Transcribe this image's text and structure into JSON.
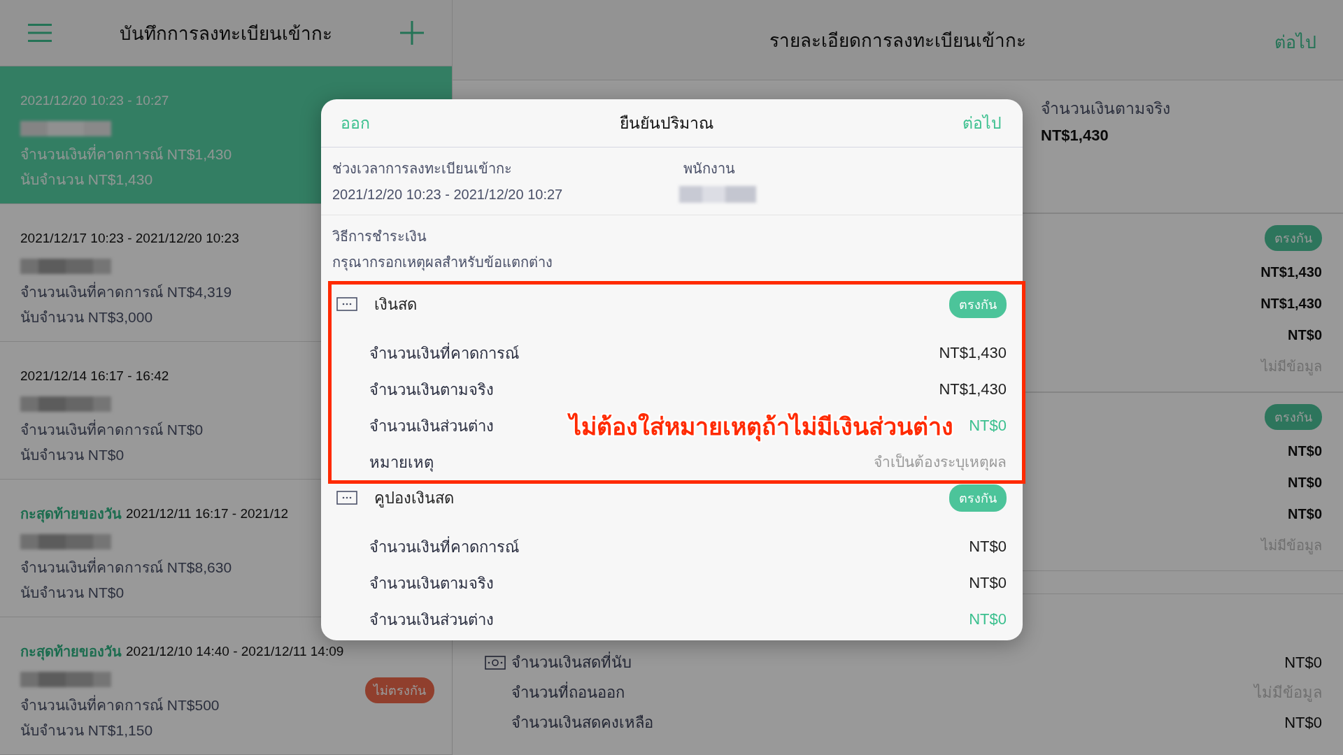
{
  "list_header": {
    "title": "บันทึกการลงทะเบียนเข้ากะ"
  },
  "shifts": [
    {
      "selected": true,
      "period": "2021/12/20 10:23 - 10:27",
      "expected": "จำนวนเงินที่คาดการณ์ NT$1,430",
      "counted": "นับจำนวน NT$1,430"
    },
    {
      "selected": false,
      "period": "2021/12/17 10:23 - 2021/12/20 10:23",
      "expected": "จำนวนเงินที่คาดการณ์ NT$4,319",
      "counted": "นับจำนวน NT$3,000"
    },
    {
      "selected": false,
      "period": "2021/12/14 16:17 - 16:42",
      "expected": "จำนวนเงินที่คาดการณ์ NT$0",
      "counted": "นับจำนวน NT$0"
    },
    {
      "selected": false,
      "prefix": "กะสุดท้ายของวัน",
      "period": "2021/12/11 16:17 - 2021/12",
      "expected": "จำนวนเงินที่คาดการณ์ NT$8,630",
      "counted": "นับจำนวน NT$0"
    },
    {
      "selected": false,
      "prefix": "กะสุดท้ายของวัน",
      "period": "2021/12/10 14:40 - 2021/12/11 14:09",
      "badge": "ไม่ตรงกัน",
      "expected": "จำนวนเงินที่คาดการณ์ NT$500",
      "counted": "นับจำนวน NT$1,150"
    }
  ],
  "detail_header": {
    "title": "รายละเอียดการลงทะเบียนเข้ากะ",
    "next": "ต่อไป"
  },
  "detail": {
    "actual_label": "จำนวนเงินตามจริง",
    "actual_value": "NT$1,430",
    "groups": [
      {
        "badge": "ตรงกัน",
        "values": [
          {
            "text": "NT$1,430",
            "muted": false
          },
          {
            "text": "NT$1,430",
            "muted": false
          },
          {
            "text": "NT$0",
            "muted": false
          },
          {
            "text": "ไม่มีข้อมูล",
            "muted": true
          }
        ]
      },
      {
        "badge": "ตรงกัน",
        "values": [
          {
            "text": "NT$0",
            "muted": false
          },
          {
            "text": "NT$0",
            "muted": false
          },
          {
            "text": "NT$0",
            "muted": false
          },
          {
            "text": "ไม่มีข้อมูล",
            "muted": true
          }
        ]
      }
    ],
    "cash_summary": [
      {
        "label": "จำนวนเงินสดที่นับ",
        "value": "NT$0",
        "muted": false,
        "icon": true
      },
      {
        "label": "จำนวนที่ถอนออก",
        "value": "ไม่มีข้อมูล",
        "muted": true,
        "icon": false
      },
      {
        "label": "จำนวนเงินสดคงเหลือ",
        "value": "NT$0",
        "muted": false,
        "icon": false
      }
    ]
  },
  "dialog": {
    "cancel": "ออก",
    "title": "ยืนยันปริมาณ",
    "next": "ต่อไป",
    "period_label": "ช่วงเวลาการลงทะเบียนเข้ากะ",
    "period_value": "2021/12/20 10:23 - 2021/12/20 10:27",
    "staff_label": "พนักงาน",
    "payment_label": "วิธีการชำระเงิน",
    "hint": "กรุณากรอกเหตุผลสำหรับข้อแตกต่าง",
    "methods": [
      {
        "name": "เงินสด",
        "badge": "ตรงกัน",
        "highlighted": true,
        "rows": [
          {
            "kind": "amount",
            "label": "จำนวนเงินที่คาดการณ์",
            "value": "NT$1,430"
          },
          {
            "kind": "amount",
            "label": "จำนวนเงินตามจริง",
            "value": "NT$1,430"
          },
          {
            "kind": "difference",
            "label": "จำนวนเงินส่วนต่าง",
            "value": "NT$0"
          },
          {
            "kind": "note",
            "label": "หมายเหตุ",
            "placeholder": "จำเป็นต้องระบุเหตุผล"
          }
        ]
      },
      {
        "name": "คูปองเงินสด",
        "badge": "ตรงกัน",
        "highlighted": false,
        "rows": [
          {
            "kind": "amount",
            "label": "จำนวนเงินที่คาดการณ์",
            "value": "NT$0"
          },
          {
            "kind": "amount",
            "label": "จำนวนเงินตามจริง",
            "value": "NT$0"
          },
          {
            "kind": "difference",
            "label": "จำนวนเงินส่วนต่าง",
            "value": "NT$0"
          }
        ]
      }
    ]
  },
  "annotation": {
    "text": "ไม่ต้องใส่หมายเหตุถ้าไม่มีเงินส่วนต่าง"
  }
}
